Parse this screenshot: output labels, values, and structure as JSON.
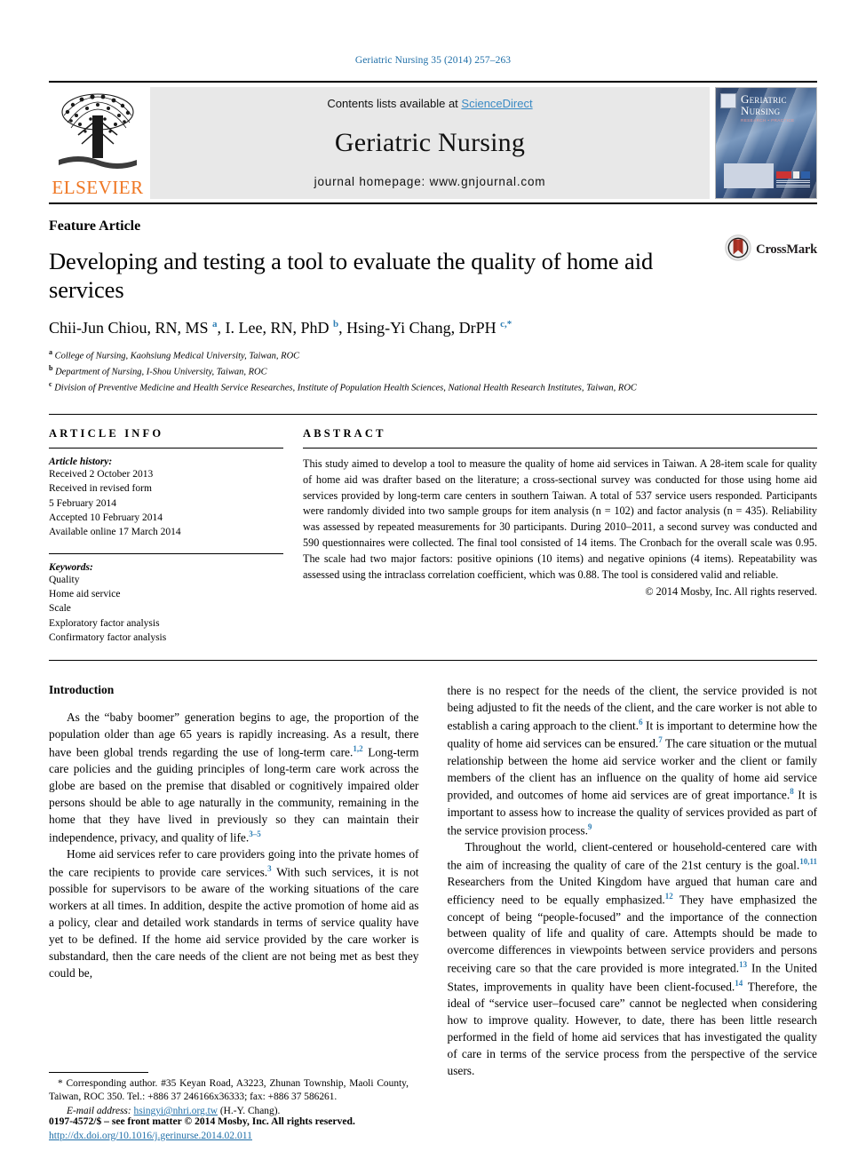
{
  "running_head": "Geriatric Nursing 35 (2014) 257–263",
  "masthead": {
    "publisher_logo_name": "ELSEVIER",
    "contents_prefix": "Contents lists available at ",
    "contents_link": "ScienceDirect",
    "journal_name": "Geriatric Nursing",
    "homepage_line": "journal homepage: www.gnjournal.com",
    "cover": {
      "title_line1": "Geriatric",
      "title_line2": "Nursing",
      "subtitle": "RESEARCH • PRACTICE"
    }
  },
  "article": {
    "category": "Feature Article",
    "title": "Developing and testing a tool to evaluate the quality of home aid services",
    "authors_html": "Chii-Jun Chiou, RN, MS <sup>a</sup>, I. Lee, RN, PhD <sup>b</sup>, Hsing-Yi Chang, DrPH <sup>c,*</sup>",
    "affiliations": [
      {
        "marker": "a",
        "text": "College of Nursing, Kaohsiung Medical University, Taiwan, ROC"
      },
      {
        "marker": "b",
        "text": "Department of Nursing, I-Shou University, Taiwan, ROC"
      },
      {
        "marker": "c",
        "text": "Division of Preventive Medicine and Health Service Researches, Institute of Population Health Sciences, National Health Research Institutes, Taiwan, ROC"
      }
    ],
    "crossmark_label": "CrossMark"
  },
  "article_info": {
    "heading": "ARTICLE INFO",
    "history_label": "Article history:",
    "history": [
      "Received 2 October 2013",
      "Received in revised form",
      "5 February 2014",
      "Accepted 10 February 2014",
      "Available online 17 March 2014"
    ],
    "keywords_label": "Keywords:",
    "keywords": [
      "Quality",
      "Home aid service",
      "Scale",
      "Exploratory factor analysis",
      "Confirmatory factor analysis"
    ]
  },
  "abstract": {
    "heading": "ABSTRACT",
    "text": "This study aimed to develop a tool to measure the quality of home aid services in Taiwan. A 28-item scale for quality of home aid was drafter based on the literature; a cross-sectional survey was conducted for those using home aid services provided by long-term care centers in southern Taiwan. A total of 537 service users responded. Participants were randomly divided into two sample groups for item analysis (n = 102) and factor analysis (n = 435). Reliability was assessed by repeated measurements for 30 participants. During 2010–2011, a second survey was conducted and 590 questionnaires were collected. The final tool consisted of 14 items. The Cronbach for the overall scale was 0.95. The scale had two major factors: positive opinions (10 items) and negative opinions (4 items). Repeatability was assessed using the intraclass correlation coefficient, which was 0.88. The tool is considered valid and reliable.",
    "copyright": "© 2014 Mosby, Inc. All rights reserved."
  },
  "body": {
    "intro_heading": "Introduction",
    "left_paragraphs_html": [
      "As the “baby boomer” generation begins to age, the proportion of the population older than age 65 years is rapidly increasing. As a result, there have been global trends regarding the use of long-term care.<sup class=\"ref\">1,2</sup> Long-term care policies and the guiding principles of long-term care work across the globe are based on the premise that disabled or cognitively impaired older persons should be able to age naturally in the community, remaining in the home that they have lived in previously so they can maintain their independence, privacy, and quality of life.<sup class=\"ref\">3–5</sup>",
      "Home aid services refer to care providers going into the private homes of the care recipients to provide care services.<sup class=\"ref\">3</sup> With such services, it is not possible for supervisors to be aware of the working situations of the care workers at all times. In addition, despite the active promotion of home aid as a policy, clear and detailed work standards in terms of service quality have yet to be defined. If the home aid service provided by the care worker is substandard, then the care needs of the client are not being met as best they could be,"
    ],
    "right_paragraphs_html": [
      "there is no respect for the needs of the client, the service provided is not being adjusted to fit the needs of the client, and the care worker is not able to establish a caring approach to the client.<sup class=\"ref\">6</sup> It is important to determine how the quality of home aid services can be ensured.<sup class=\"ref\">7</sup> The care situation or the mutual relationship between the home aid service worker and the client or family members of the client has an influence on the quality of home aid service provided, and outcomes of home aid services are of great importance.<sup class=\"ref\">8</sup> It is important to assess how to increase the quality of services provided as part of the service provision process.<sup class=\"ref\">9</sup>",
      "Throughout the world, client-centered or household-centered care with the aim of increasing the quality of care of the 21st century is the goal.<sup class=\"ref\">10,11</sup> Researchers from the United Kingdom have argued that human care and efficiency need to be equally emphasized.<sup class=\"ref\">12</sup> They have emphasized the concept of being “people-focused” and the importance of the connection between quality of life and quality of care. Attempts should be made to overcome differences in viewpoints between service providers and persons receiving care so that the care provided is more integrated.<sup class=\"ref\">13</sup> In the United States, improvements in quality have been client-focused.<sup class=\"ref\">14</sup> Therefore, the ideal of “service user–focused care” cannot be neglected when considering how to improve quality. However, to date, there has been little research performed in the field of home aid services that has investigated the quality of care in terms of the service process from the perspective of the service users."
    ],
    "first_right_paragraph_no_indent": true
  },
  "footnotes": {
    "corresponding": "* Corresponding author. #35 Keyan Road, A3223, Zhunan Township, Maoli County, Taiwan, ROC 350. Tel.: +886 37 246166x36333; fax: +886 37 586261.",
    "email_label": "E-mail address:",
    "email": "hsingyi@nhri.org.tw",
    "email_suffix": "(H.-Y. Chang).",
    "issn_line": "0197-4572/$ – see front matter © 2014 Mosby, Inc. All rights reserved.",
    "doi_line": "http://dx.doi.org/10.1016/j.gerinurse.2014.02.011"
  },
  "colors": {
    "link_blue": "#1f6fa8",
    "sciencedirect_blue": "#3a8ac4",
    "elsevier_orange": "#ef7622",
    "reference_blue": "#2f7fb5",
    "band_gray": "#e8e8e8"
  }
}
